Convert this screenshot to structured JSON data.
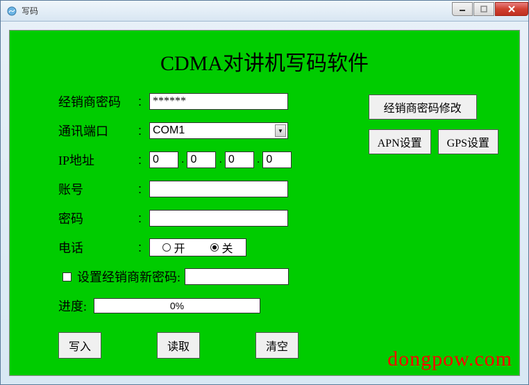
{
  "window": {
    "title": "写码"
  },
  "heading": "CDMA对讲机写码软件",
  "labels": {
    "dealerPassword": "经销商密码",
    "comPort": "通讯端口",
    "ipAddress": "IP地址",
    "account": "账号",
    "password": "密码",
    "phone": "电话",
    "setNewDealerPassword": "设置经销商新密码:",
    "progress": "进度:"
  },
  "values": {
    "dealerPassword": "******",
    "comPort": "COM1",
    "ip": {
      "o1": "0",
      "o2": "0",
      "o3": "0",
      "o4": "0"
    },
    "account": "",
    "password": "",
    "newDealerPassword": "",
    "progressText": "0%"
  },
  "radio": {
    "on": "开",
    "off": "关",
    "selected": "off"
  },
  "buttons": {
    "write": "写入",
    "read": "读取",
    "clear": "清空",
    "changeDealerPassword": "经销商密码修改",
    "apnSettings": "APN设置",
    "gpsSettings": "GPS设置"
  },
  "watermark": "dongpow.com"
}
